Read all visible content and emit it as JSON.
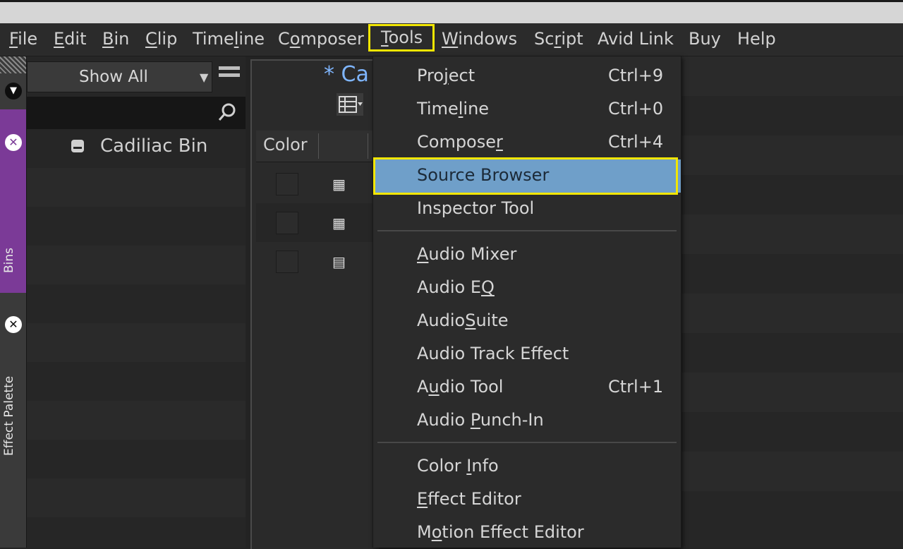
{
  "menubar": {
    "items": [
      {
        "label": "File",
        "underline": "F",
        "rest": "ile"
      },
      {
        "label": "Edit",
        "underline": "E",
        "rest": "dit"
      },
      {
        "label": "Bin",
        "underline": "B",
        "rest": "in"
      },
      {
        "label": "Clip",
        "underline": "C",
        "rest": "lip"
      }
    ],
    "timeline_pre": "Time",
    "timeline_u": "l",
    "timeline_post": "ine",
    "composer_pre": "C",
    "composer_u": "o",
    "composer_post": "mposer",
    "tools_u": "T",
    "tools_post": "ools",
    "windows_u": "W",
    "windows_post": "indows",
    "script_pre": "Sc",
    "script_u": "r",
    "script_post": "ipt",
    "avidlink": "Avid Link",
    "buy": "Buy",
    "help": "Help"
  },
  "siderail": {
    "bins_label": "Bins",
    "effect_palette_label": "Effect Palette"
  },
  "leftpanel": {
    "filter_value": "Show All",
    "bin_name": "Cadiliac Bin"
  },
  "binwindow": {
    "title": "* Ca",
    "column_color": "Color",
    "row_icons": [
      "▦",
      "▦",
      "▤"
    ]
  },
  "tools_menu": {
    "group1": [
      {
        "pre": "Pro",
        "u": "j",
        "post": "ect",
        "shortcut": "Ctrl+9"
      },
      {
        "pre": "Time",
        "u": "l",
        "post": "ine",
        "shortcut": "Ctrl+0"
      },
      {
        "pre": "Compose",
        "u": "r",
        "post": "",
        "shortcut": "Ctrl+4"
      },
      {
        "pre": "Source Browser",
        "u": "",
        "post": "",
        "shortcut": ""
      },
      {
        "pre": "Inspector Tool",
        "u": "",
        "post": "",
        "shortcut": ""
      }
    ],
    "group2": [
      {
        "pre": "",
        "u": "A",
        "post": "udio Mixer",
        "shortcut": ""
      },
      {
        "pre": "Audio E",
        "u": "Q",
        "post": "",
        "shortcut": ""
      },
      {
        "pre": "Audio",
        "u": "S",
        "post": "uite",
        "shortcut": ""
      },
      {
        "pre": "Audio Track Effect",
        "u": "",
        "post": "",
        "shortcut": ""
      },
      {
        "pre": "A",
        "u": "u",
        "post": "dio Tool",
        "shortcut": "Ctrl+1"
      },
      {
        "pre": "Audio ",
        "u": "P",
        "post": "unch-In",
        "shortcut": ""
      }
    ],
    "group3": [
      {
        "pre": "Color ",
        "u": "I",
        "post": "nfo",
        "shortcut": ""
      },
      {
        "pre": "",
        "u": "E",
        "post": "ffect Editor",
        "shortcut": ""
      },
      {
        "pre": "M",
        "u": "o",
        "post": "tion Effect Editor",
        "shortcut": ""
      }
    ]
  },
  "colors": {
    "highlight": "#6f9fc9",
    "callout": "#f2e600",
    "bins_tab": "#7b3a97",
    "bin_title": "#7fb6ff"
  }
}
